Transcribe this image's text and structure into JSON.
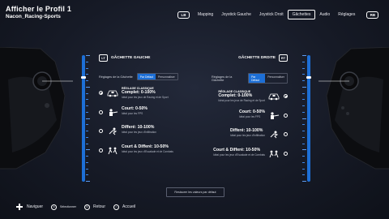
{
  "header": {
    "title": "Afficher le Profil 1",
    "subtitle": "Nacon_Racing-Sports",
    "lb": "LB",
    "rb": "RB",
    "tabs": [
      {
        "label": "Mapping",
        "active": false
      },
      {
        "label": "Joystick Gauche",
        "active": false
      },
      {
        "label": "Joystick Droit",
        "active": false
      },
      {
        "label": "Gâchettes",
        "active": true
      },
      {
        "label": "Audio",
        "active": false
      },
      {
        "label": "Réglages",
        "active": false
      }
    ]
  },
  "left_panel": {
    "badge": "LT",
    "title": "GÂCHETTE GAUCHE",
    "setting_label": "Réglages de la Gâchette",
    "segments": [
      "Par Défaut",
      "Personnaliser"
    ],
    "selected_segment": "Par Défaut",
    "options": [
      {
        "tag": "RÉGLAGE CLASSIQUE",
        "name": "Complet: 0-100%",
        "desc": "Idéal pour les jeux de Racing et de Sport",
        "selected": true,
        "icon": "car-icon"
      },
      {
        "tag": "",
        "name": "Court: 0-50%",
        "desc": "Idéal pour les FPS",
        "selected": false,
        "icon": "soldier-icon"
      },
      {
        "tag": "",
        "name": "Differé: 10-100%",
        "desc": "Idéal pour les jeux d'Infiltration",
        "selected": false,
        "icon": "sneak-icon"
      },
      {
        "tag": "",
        "name": "Court & Differé: 10-50%",
        "desc": "Idéal pour les jeux d'Escalade et de Combats",
        "selected": false,
        "icon": "fight-icon"
      }
    ]
  },
  "right_panel": {
    "badge": "RT",
    "title": "GÂCHETTE DROITE",
    "setting_label": "Réglages de la Gâchette",
    "segments": [
      "Par Défaut",
      "Personnaliser"
    ],
    "selected_segment": "Par Défaut",
    "options": [
      {
        "tag": "RÉGLAGE CLASSIQUE",
        "name": "Complet: 0-100%",
        "desc": "Idéal pour les jeux de Racing et de Sport",
        "selected": true,
        "icon": "car-icon"
      },
      {
        "tag": "",
        "name": "Court: 0-50%",
        "desc": "Idéal pour les FPS",
        "selected": false,
        "icon": "soldier-icon"
      },
      {
        "tag": "",
        "name": "Differé: 10-100%",
        "desc": "Idéal pour les jeux d'Infiltration",
        "selected": false,
        "icon": "sneak-icon"
      },
      {
        "tag": "",
        "name": "Court & Differé: 10-50%",
        "desc": "Idéal pour les jeux d'Escalade et de Combats",
        "selected": false,
        "icon": "fight-icon"
      }
    ]
  },
  "reset_label": "Restaurer les valeurs par défaut",
  "footer": {
    "navigate": "Naviguer",
    "a_btn": "A",
    "select": "Sélectionner",
    "b_btn": "B",
    "back": "Retour",
    "home_btn": "⌂",
    "home": "Accueil"
  },
  "colors": {
    "accent": "#1d6fd6",
    "background": "#161a26",
    "text": "#ffffff"
  }
}
